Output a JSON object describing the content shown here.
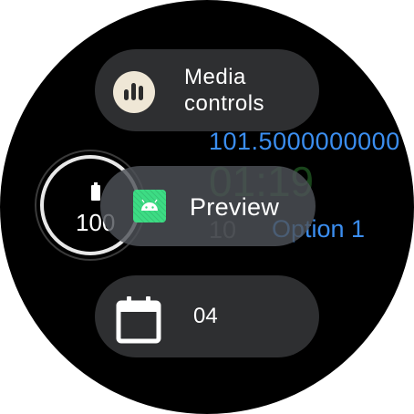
{
  "background": {
    "number_text": "101.5000000000",
    "time_text": "01:19",
    "small_text": "10",
    "option_text": "Option 1"
  },
  "media_chip": {
    "label_line1": "Media",
    "label_line2": "controls",
    "icon": "media-bars-icon"
  },
  "battery": {
    "value": "100",
    "icon": "battery-icon",
    "ring_color": "#e8e8e8"
  },
  "preview": {
    "label": "Preview",
    "icon": "android-app-icon",
    "icon_color": "#3ddc84"
  },
  "date_chip": {
    "value": "04",
    "icon": "calendar-icon"
  },
  "colors": {
    "accent_blue": "#3b8ef0",
    "time_green": "#2e7d32",
    "chip_bg": "#2e2f31"
  }
}
